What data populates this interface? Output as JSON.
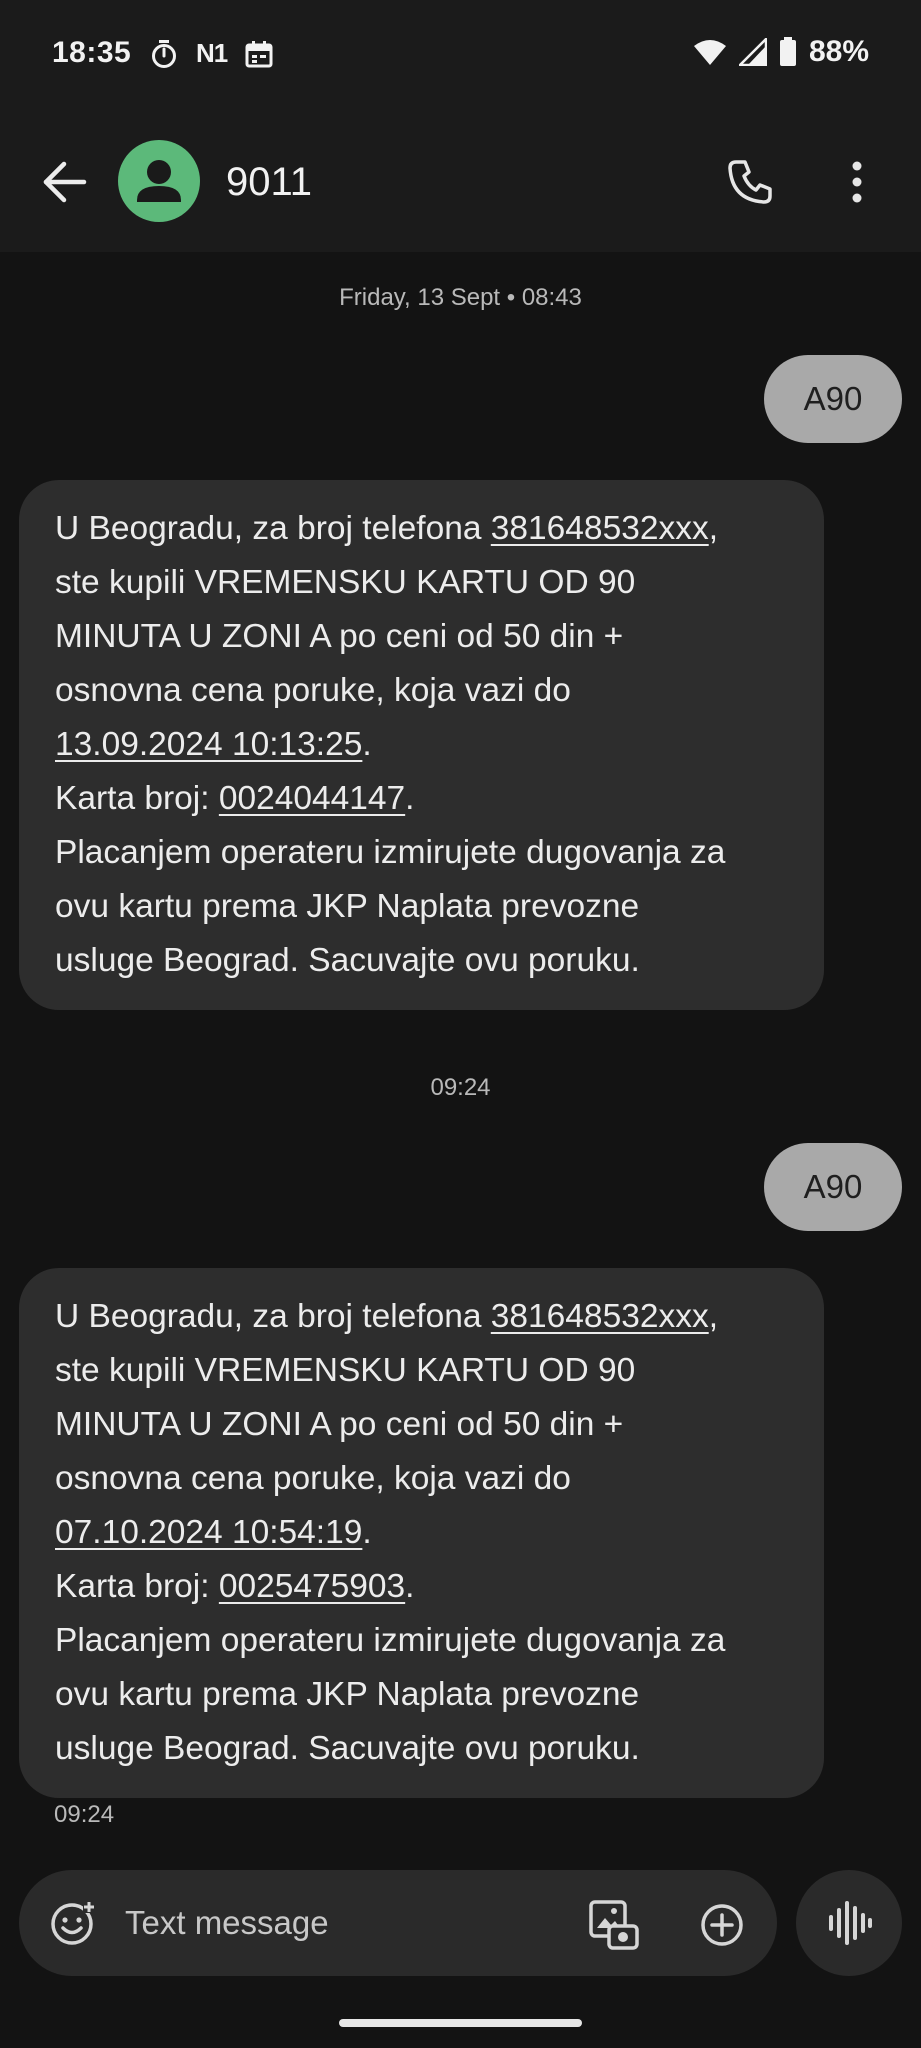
{
  "status_bar": {
    "time": "18:35",
    "n1_label": "N1",
    "battery_percent": "88%"
  },
  "header": {
    "contact_name": "9011"
  },
  "conversation": {
    "date_separator": "Friday, 13 Sept • 08:43",
    "time_separator": "09:24",
    "messages": [
      {
        "direction": "outgoing",
        "text": "A90"
      },
      {
        "direction": "incoming",
        "lines": [
          {
            "pre": "U Beogradu, za broj telefona ",
            "link": "381648532xxx",
            "post": ","
          },
          {
            "text": "ste kupili VREMENSKU KARTU OD 90"
          },
          {
            "text": "MINUTA U ZONI A po ceni od 50 din +"
          },
          {
            "text": "osnovna cena poruke, koja vazi do"
          },
          {
            "link": "13.09.2024 10:13:25",
            "post": "."
          },
          {
            "pre": "Karta broj: ",
            "link": "0024044147",
            "post": "."
          },
          {
            "text": "Placanjem operateru izmirujete dugovanja za"
          },
          {
            "text": "ovu kartu prema JKP Naplata prevozne"
          },
          {
            "text": "usluge Beograd. Sacuvajte ovu poruku."
          }
        ]
      },
      {
        "direction": "outgoing",
        "text": "A90"
      },
      {
        "direction": "incoming",
        "lines": [
          {
            "pre": "U Beogradu, za broj telefona ",
            "link": "381648532xxx",
            "post": ","
          },
          {
            "text": "ste kupili VREMENSKU KARTU OD 90"
          },
          {
            "text": "MINUTA U ZONI A po ceni od 50 din +"
          },
          {
            "text": "osnovna cena poruke, koja vazi do"
          },
          {
            "link": "07.10.2024 10:54:19",
            "post": "."
          },
          {
            "pre": "Karta broj: ",
            "link": "0025475903",
            "post": "."
          },
          {
            "text": "Placanjem operateru izmirujete dugovanja za"
          },
          {
            "text": "ovu kartu prema JKP Naplata prevozne"
          },
          {
            "text": "usluge Beograd. Sacuvajte ovu poruku."
          }
        ],
        "timestamp": "09:24"
      }
    ]
  },
  "composer": {
    "placeholder": "Text message"
  },
  "icons": {
    "back": "arrow-back-icon",
    "avatar": "person-icon",
    "call": "phone-icon",
    "more": "more-vert-icon",
    "emoji": "emoji-icon",
    "gallery": "gallery-icon",
    "add": "add-circle-icon",
    "voice": "voice-wave-icon"
  },
  "colors": {
    "background": "#131313",
    "bar": "#1b1b1b",
    "avatar": "#5cb97a",
    "incoming_bubble": "#2d2d2d",
    "outgoing_bubble": "#a9a9a9",
    "composer": "#2a2a2a"
  }
}
